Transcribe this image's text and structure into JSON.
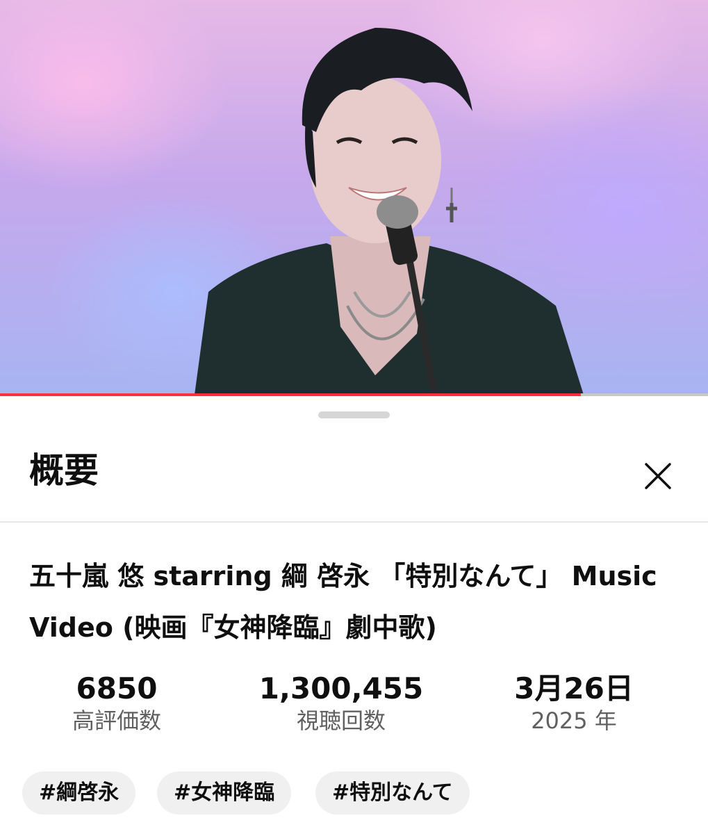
{
  "player": {
    "progress": 0.82,
    "accent_color": "#ff2f3b"
  },
  "sheet": {
    "title": "概要",
    "close_icon": "close-icon"
  },
  "video": {
    "title": "五十嵐 悠 starring 綱 啓永 「特別なんて」 Music Video (映画『女神降臨』劇中歌)"
  },
  "stats": [
    {
      "value": "6850",
      "label": "高評価数"
    },
    {
      "value": "1,300,455",
      "label": "視聴回数"
    },
    {
      "value": "3月26日",
      "label": "2025 年"
    }
  ],
  "tags": [
    "#綱啓永",
    "#女神降臨",
    "#特別なんて"
  ]
}
